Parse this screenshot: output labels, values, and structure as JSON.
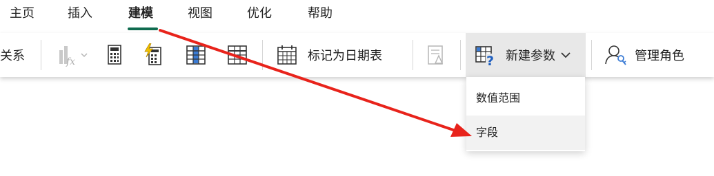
{
  "menu": {
    "tabs": [
      {
        "label": "主页"
      },
      {
        "label": "插入"
      },
      {
        "label": "建模"
      },
      {
        "label": "视图"
      },
      {
        "label": "优化"
      },
      {
        "label": "帮助"
      }
    ],
    "active_tab": "建模"
  },
  "ribbon": {
    "relationships_label": "关系",
    "mark_date_table_label": "标记为日期表",
    "new_parameter_label": "新建参数",
    "manage_roles_label": "管理角色"
  },
  "dropdown": {
    "items": [
      {
        "label": "数值范围"
      },
      {
        "label": "字段"
      }
    ]
  },
  "colors": {
    "active_tab_underline": "#0f6b4f",
    "arrow": "#e8231b",
    "active_button_bg": "#e8e8e8"
  }
}
